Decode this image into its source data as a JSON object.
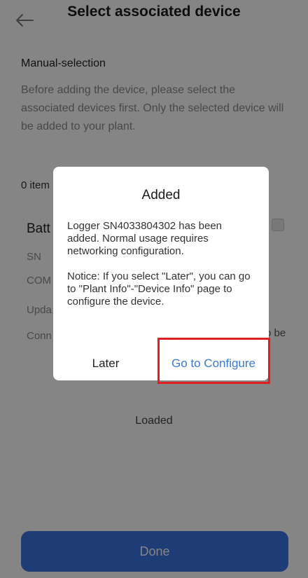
{
  "header": {
    "title": "Select associated device",
    "back_icon": "arrow-left-icon"
  },
  "manual": {
    "title": "Manual-selection",
    "description": "Before adding the device, please select the associated devices first. Only the selected device will be added to your plant."
  },
  "list": {
    "count_text": "0 item",
    "card": {
      "title": "Batt",
      "rows": [
        "SN",
        "COM",
        "Upda",
        "Conn"
      ],
      "note": "ed to be"
    },
    "loaded_text": "Loaded"
  },
  "footer": {
    "done_label": "Done",
    "done_color": "#3b74e0"
  },
  "dialog": {
    "title": "Added",
    "message": "Logger SN4033804302 has been added. Normal usage requires networking configuration.",
    "notice": "Notice: If you select \"Later\", you can go to \"Plant Info\"-\"Device Info\" page to configure the device.",
    "later_label": "Later",
    "configure_label": "Go to Configure",
    "configure_color": "#3b78d9",
    "highlight_color": "#e11d1d"
  }
}
